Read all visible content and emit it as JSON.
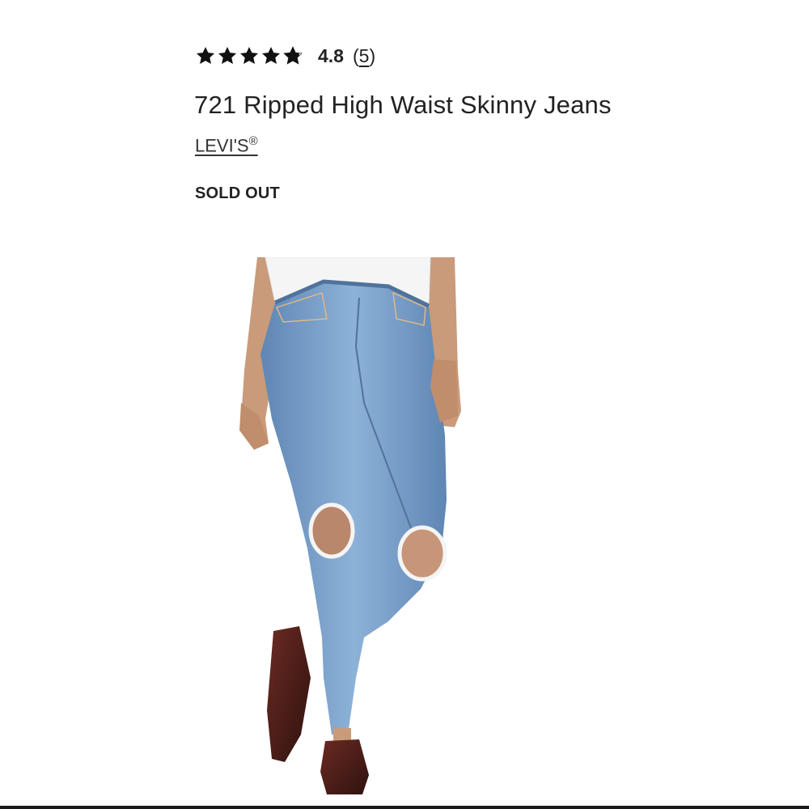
{
  "product": {
    "rating": {
      "stars_filled": 4.8,
      "stars_total": 5,
      "value": "4.8",
      "count_open": "(",
      "count": "5",
      "count_close": ")"
    },
    "title": "721 Ripped High Waist Skinny Jeans",
    "brand": "LEVI'S",
    "brand_mark": "®",
    "status": "SOLD OUT",
    "image": {
      "icon": "product-photo-jeans"
    }
  },
  "colors": {
    "text": "#222222",
    "star": "#111111",
    "denim": "#7fa6cf",
    "shoe": "#4a1f1a"
  }
}
